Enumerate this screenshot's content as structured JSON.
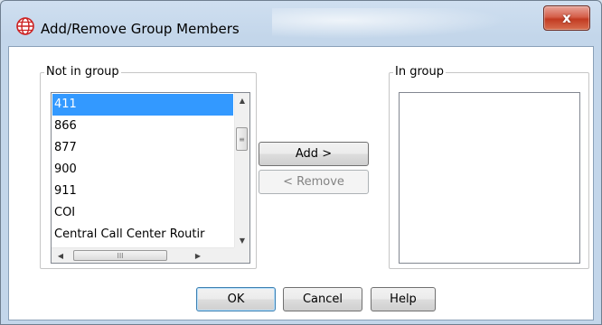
{
  "window": {
    "title": "Add/Remove Group Members",
    "close_label": "x"
  },
  "not_in_group": {
    "label": "Not in group",
    "items": [
      "411",
      "866",
      "877",
      "900",
      "911",
      "COI",
      "Central Call Center Routir"
    ],
    "selected_index": 0
  },
  "in_group": {
    "label": "In group",
    "items": []
  },
  "actions": {
    "add_label": "Add >",
    "remove_label": "< Remove"
  },
  "footer": {
    "ok_label": "OK",
    "cancel_label": "Cancel",
    "help_label": "Help"
  },
  "scrollbar": {
    "up_arrow": "▲",
    "down_arrow": "▼",
    "left_arrow": "◀",
    "right_arrow": "▶",
    "grip_v": "≡",
    "grip_h": "III"
  },
  "colors": {
    "selection": "#3399ff",
    "close_button": "#c23b22",
    "title_icon": "#cc2222"
  }
}
